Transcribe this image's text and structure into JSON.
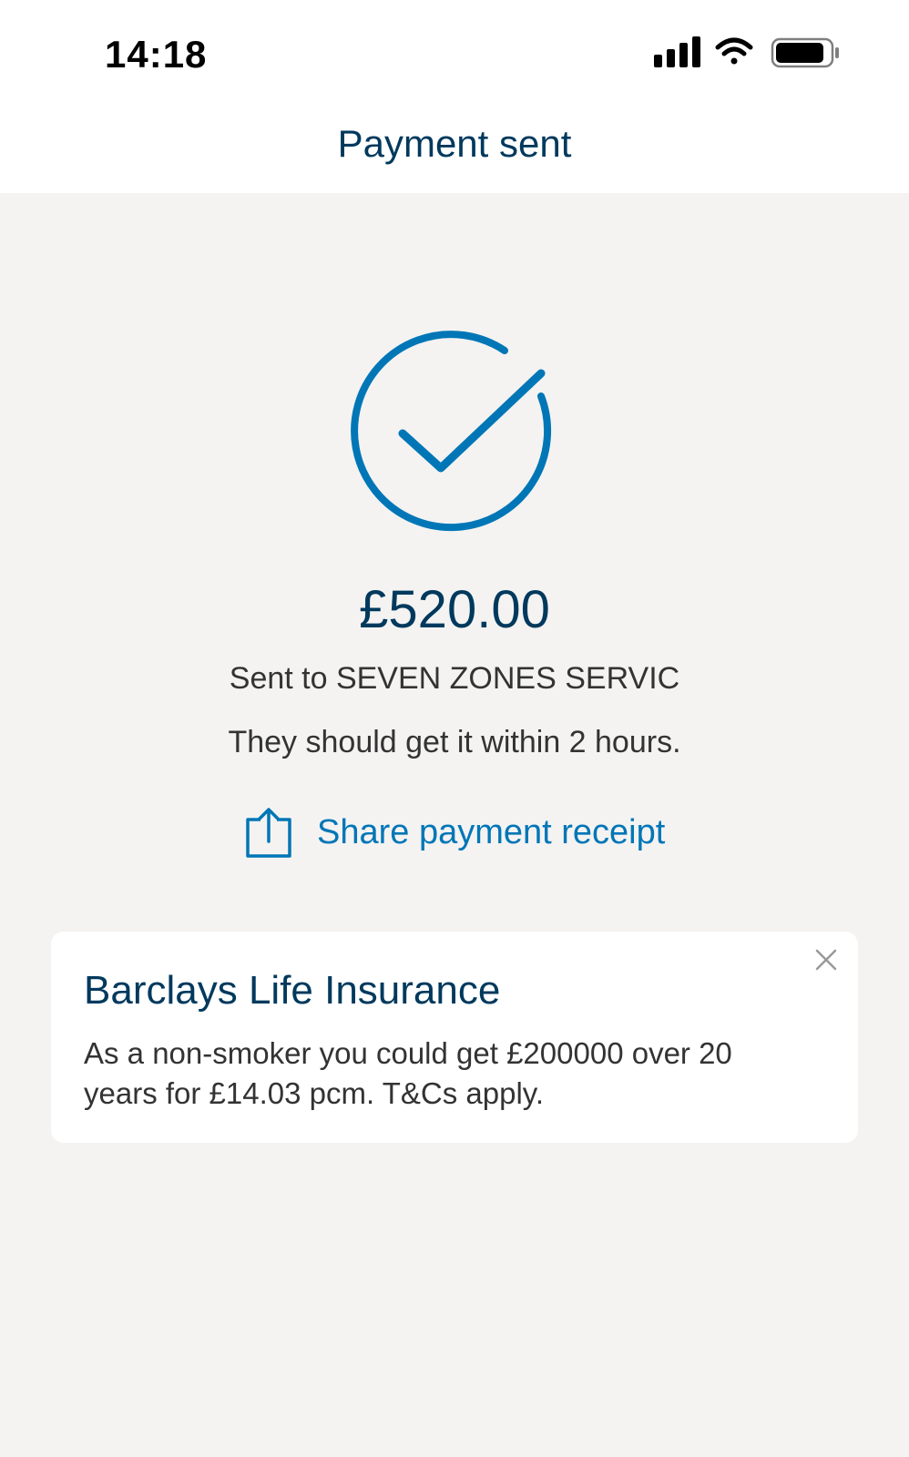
{
  "status_bar": {
    "time": "14:18",
    "icons": [
      "signal-icon",
      "wifi-icon",
      "battery-icon"
    ]
  },
  "nav": {
    "title": "Payment sent"
  },
  "confirmation": {
    "icon": "check-circle-icon",
    "amount": "£520.00",
    "recipient_text": "Sent to SEVEN ZONES SERVIC",
    "eta_text": "They should get it within 2 hours.",
    "share_label": "Share payment receipt",
    "share_icon": "share-icon"
  },
  "promo_card": {
    "title": "Barclays Life Insurance",
    "body": "As a non-smoker you could get £200000 over 20 years for £14.03 pcm. T&Cs apply.",
    "close_icon": "close-icon"
  },
  "colors": {
    "navy": "#00395d",
    "accent_blue": "#0076b6",
    "background": "#f4f3f2",
    "text": "#333333"
  }
}
